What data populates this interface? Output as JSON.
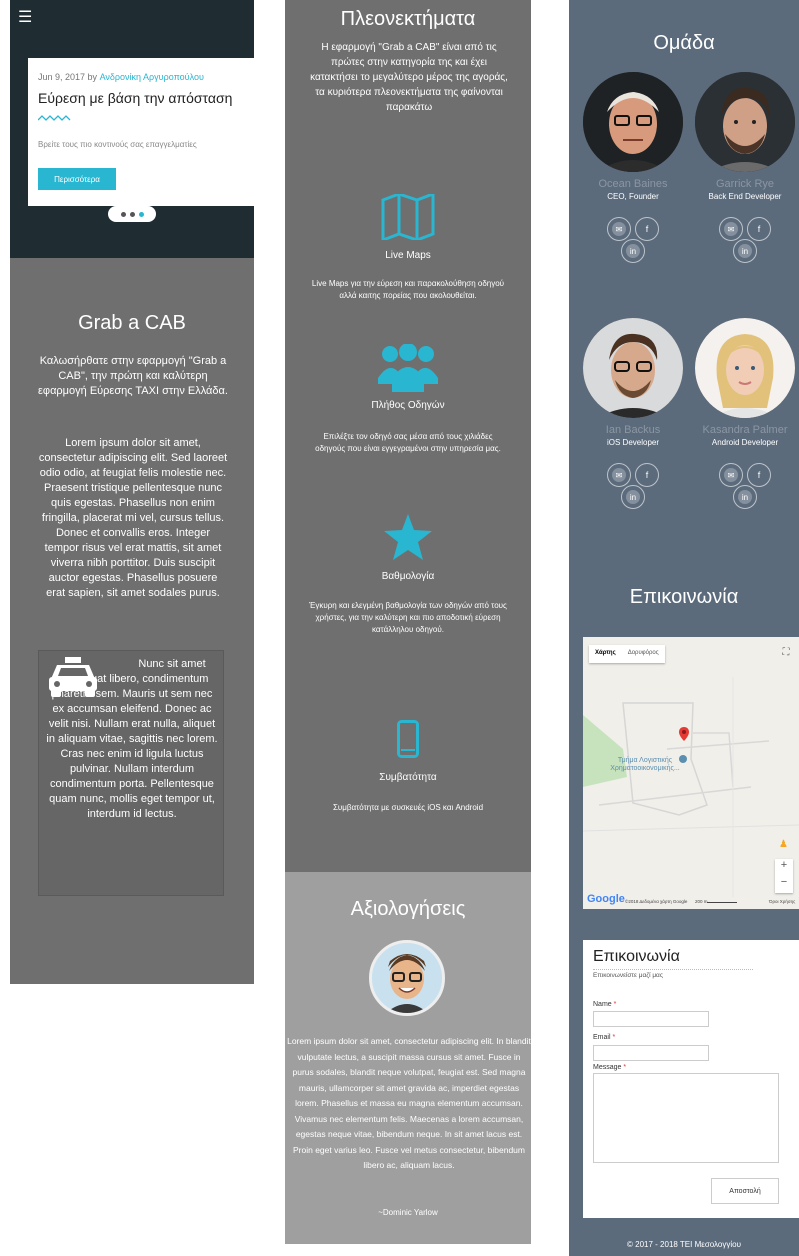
{
  "hero": {
    "menu_icon": "hamburger-icon",
    "slide": {
      "date": "Jun 9, 2017",
      "by": " by ",
      "author": "Ανδρονίκη Αργυροπούλου",
      "title": "Εύρεση με βάση την απόσταση",
      "text": "Βρείτε τους πιο κοντινούς σας επαγγελματίες",
      "button": "Περισσότερα"
    },
    "carousel": {
      "total": 3,
      "active": 3
    }
  },
  "grab": {
    "title": "Grab a CAB",
    "intro": "Καλωσήρθατε στην εφαρμογή \"Grab a CAB\", την πρώτη και καλύτερη εφαρμογή Εύρεσης ΤΑΧΙ στην Ελλάδα.",
    "lorem": "Lorem ipsum dolor sit amet, consectetur adipiscing elit. Sed laoreet odio odio, at feugiat felis molestie nec. Praesent tristique pellentesque nunc quis egestas. Phasellus non enim fringilla, placerat mi vel, cursus tellus. Donec et convallis eros. Integer tempor risus vel erat mattis, sit amet viverra nibh porttitor. Duis suscipit auctor egestas. Phasellus posuere erat sapien, sit amet sodales purus.",
    "box_text": "Nunc sit amet consequat libero, condimentum pharetra sem. Mauris ut sem nec ex accumsan eleifend. Donec ac velit nisi. Nullam erat nulla, aliquet in aliquam vitae, sagittis nec lorem. Cras nec enim id ligula luctus pulvinar. Nullam interdum condimentum porta. Pellentesque quam nunc, mollis eget tempor ut, interdum id lectus."
  },
  "advantages": {
    "title": "Πλεονεκτήματα",
    "lead": "Η εφαρμογή \"Grab a CAB\" είναι από τις πρώτες στην κατηγορία της και έχει κατακτήσει το μεγαλύτερο μέρος της αγοράς, τα κυριότερα πλεονεκτήματα της φαίνονται παρακάτω",
    "features": [
      {
        "icon": "map-icon",
        "title": "Live Maps",
        "text": "Live Maps για την εύρεση και παρακολούθηση οδηγού αλλά καιτης πορείας που ακολουθείται."
      },
      {
        "icon": "users-icon",
        "title": "Πλήθος Οδηγών",
        "text": "Επιλέξτε τον οδηγό σας μέσα από τους χιλιάδες οδηγούς που είναι εγγεγραμένοι στην υπηρεσία μας."
      },
      {
        "icon": "star-icon",
        "title": "Βαθμολογία",
        "text": "Έγκυρη και ελεγμένη βαθμολογία των οδηγών από τους χρήστες, για την καλύτερη και πιο αποδοτική εύρεση κατάλληλου οδηγού."
      },
      {
        "icon": "mobile-icon",
        "title": "Συμβατότητα",
        "text": "Συμβατότητα με συσκευές iOS και Android"
      }
    ]
  },
  "reviews": {
    "title": "Αξιολογήσεις",
    "text": "Lorem ipsum dolor sit amet, consectetur adipiscing elit. In blandit vulputate lectus, a suscipit massa cursus sit amet. Fusce in purus sodales, blandit neque volutpat, feugiat est. Sed magna mauris, ullamcorper sit amet gravida ac, imperdiet egestas lorem. Phasellus et massa eu magna elementum accumsan. Vivamus nec elementum felis. Maecenas a lorem accumsan, egestas neque vitae, bibendum neque. In sit amet lacus est. Proin eget varius leo. Fusce vel metus consectetur, bibendum libero ac, aliquam lacus.",
    "author": "~Dominic Yarlow"
  },
  "team": {
    "title": "Ομάδα",
    "members": [
      {
        "name": "Ocean Baines",
        "role": "CEO, Founder"
      },
      {
        "name": "Garrick Rye",
        "role": "Back End Developer"
      },
      {
        "name": "Ian Backus",
        "role": "iOS Developer"
      },
      {
        "name": "Kasandra Palmer",
        "role": "Android Developer"
      }
    ]
  },
  "contact": {
    "title": "Επικοινωνία",
    "map": {
      "tab_map": "Χάρτης",
      "tab_satellite": "Δορυφόρος",
      "place": "Τμήμα Λογιστικής Χρηματοοικονομικής...",
      "google": "Google",
      "attribution": "©2018 Δεδομένα χάρτη Google",
      "scale": "200 m",
      "terms": "Όροι Χρήσης"
    },
    "form": {
      "title": "Επικοινωνία",
      "subtitle": "Επικοινωνείστε μαζί μας",
      "name_label": "Name",
      "email_label": "Email",
      "message_label": "Message",
      "required": "*",
      "submit": "Αποστολή"
    }
  },
  "footer": "© 2017 - 2018 ΤΕΙ Μεσολογγίου",
  "colors": {
    "accent": "#29b6d1",
    "dark": "#1f2d33",
    "gray": "#6f6f6f",
    "slate": "#5b6b7c"
  }
}
